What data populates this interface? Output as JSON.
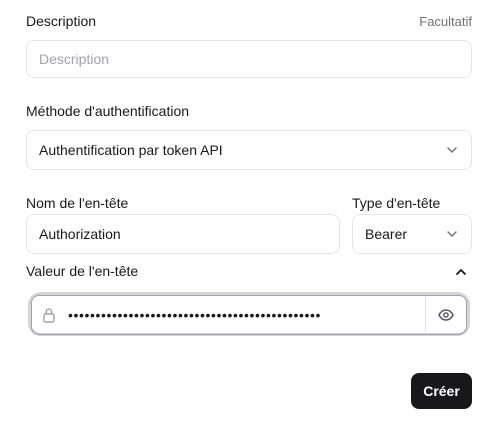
{
  "description": {
    "label": "Description",
    "optional": "Facultatif",
    "placeholder": "Description"
  },
  "auth_method": {
    "label": "Méthode d'authentification",
    "value": "Authentification par token API"
  },
  "header_name": {
    "label": "Nom de l'en-tête",
    "value": "Authorization"
  },
  "header_type": {
    "label": "Type d'en-tête",
    "value": "Bearer"
  },
  "header_value": {
    "label": "Valeur de l'en-tête",
    "masked": "••••••••••••••••••••••••••••••••••••••••••••••"
  },
  "actions": {
    "create_label": "Créer"
  },
  "icons": {
    "auth_chevron": "chevron-down-icon",
    "type_chevron": "chevron-down-icon",
    "collapse": "chevron-up-icon",
    "lock": "lock-icon",
    "eye": "eye-icon"
  }
}
